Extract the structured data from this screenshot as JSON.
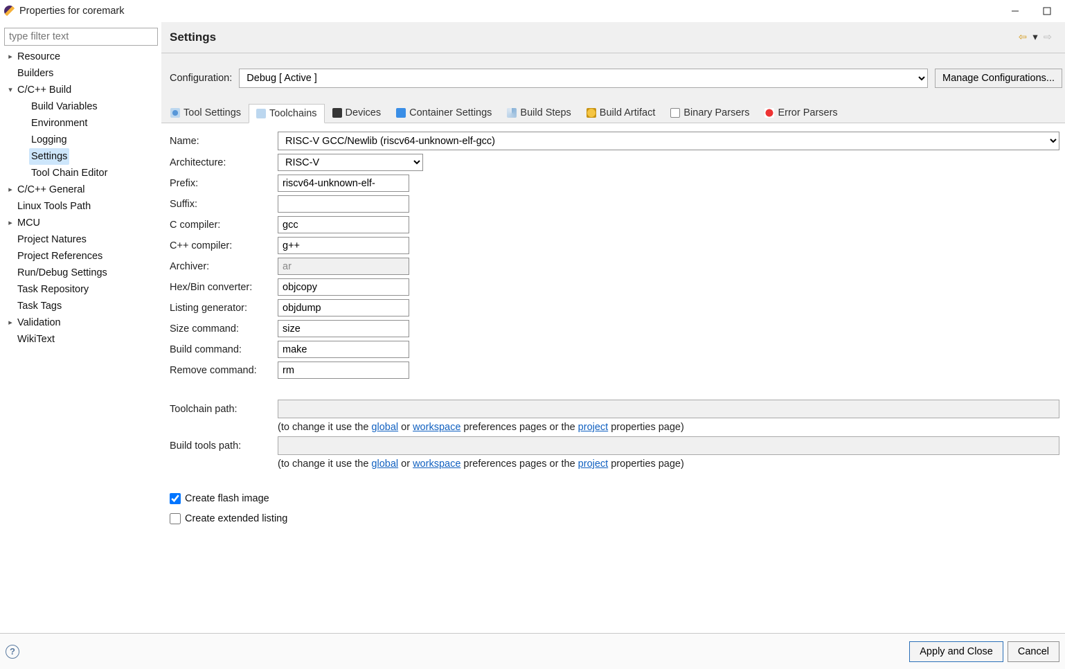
{
  "window": {
    "title": "Properties for coremark"
  },
  "sidebar": {
    "filter_placeholder": "type filter text",
    "tree": {
      "resource": "Resource",
      "builders": "Builders",
      "ccbuild": "C/C++ Build",
      "ccbuild_children": {
        "build_variables": "Build Variables",
        "environment": "Environment",
        "logging": "Logging",
        "settings": "Settings",
        "tool_chain_editor": "Tool Chain Editor"
      },
      "ccgeneral": "C/C++ General",
      "linux_tools_path": "Linux Tools Path",
      "mcu": "MCU",
      "project_natures": "Project Natures",
      "project_references": "Project References",
      "run_debug_settings": "Run/Debug Settings",
      "task_repository": "Task Repository",
      "task_tags": "Task Tags",
      "validation": "Validation",
      "wikitext": "WikiText"
    }
  },
  "main": {
    "heading": "Settings",
    "configuration_label": "Configuration:",
    "configuration_value": "Debug  [ Active ]",
    "manage_configurations": "Manage Configurations...",
    "tabs": {
      "tool_settings": "Tool Settings",
      "toolchains": "Toolchains",
      "devices": "Devices",
      "container_settings": "Container Settings",
      "build_steps": "Build Steps",
      "build_artifact": "Build Artifact",
      "binary_parsers": "Binary Parsers",
      "error_parsers": "Error Parsers"
    },
    "form": {
      "name_label": "Name:",
      "name_value": "RISC-V GCC/Newlib (riscv64-unknown-elf-gcc)",
      "architecture_label": "Architecture:",
      "architecture_value": "RISC-V",
      "prefix_label": "Prefix:",
      "prefix_value": "riscv64-unknown-elf-",
      "suffix_label": "Suffix:",
      "suffix_value": "",
      "c_compiler_label": "C compiler:",
      "c_compiler_value": "gcc",
      "cpp_compiler_label": "C++ compiler:",
      "cpp_compiler_value": "g++",
      "archiver_label": "Archiver:",
      "archiver_value": "ar",
      "hexbin_label": "Hex/Bin converter:",
      "hexbin_value": "objcopy",
      "listing_label": "Listing generator:",
      "listing_value": "objdump",
      "size_label": "Size command:",
      "size_value": "size",
      "build_cmd_label": "Build command:",
      "build_cmd_value": "make",
      "remove_cmd_label": "Remove command:",
      "remove_cmd_value": "rm",
      "toolchain_path_label": "Toolchain path:",
      "toolchain_path_value": "",
      "build_tools_path_label": "Build tools path:",
      "build_tools_path_value": "",
      "hint_pre": "(to change it use the ",
      "hint_global": "global",
      "hint_or": " or ",
      "hint_workspace": "workspace",
      "hint_pref": " preferences pages or the ",
      "hint_project": "project",
      "hint_post": " properties page)",
      "create_flash_image": "Create flash image",
      "create_extended_listing": "Create extended listing"
    }
  },
  "footer": {
    "apply_and_close": "Apply and Close",
    "cancel": "Cancel"
  }
}
